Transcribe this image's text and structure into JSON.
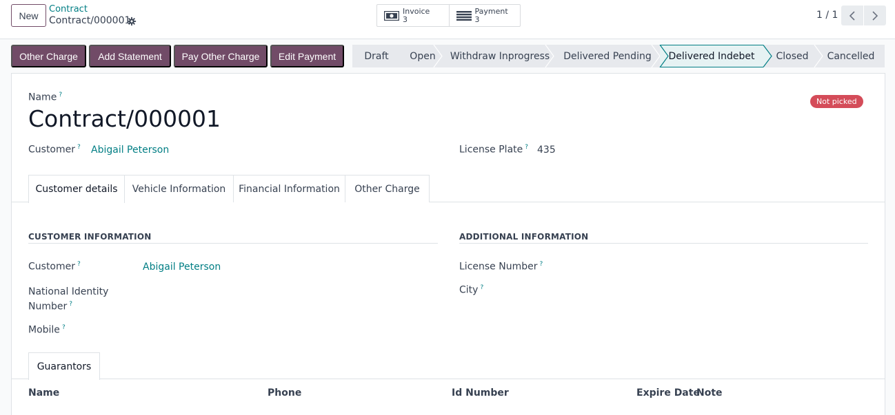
{
  "header": {
    "new_label": "New",
    "breadcrumb": "Contract",
    "record_name": "Contract/000001",
    "smart_buttons": [
      {
        "label": "Invoice",
        "count": "3",
        "icon": "money-icon"
      },
      {
        "label": "Payment",
        "count": "3",
        "icon": "list-icon"
      }
    ],
    "pager": "1 / 1"
  },
  "actions": [
    "Other Charge",
    "Add Statement",
    "Pay Other Charge",
    "Edit Payment"
  ],
  "statusbar": {
    "stages": [
      "Draft",
      "Open",
      "Withdraw Inprogress",
      "Delivered Pending",
      "Delivered Indebet",
      "Closed",
      "Cancelled"
    ],
    "active": "Delivered Indebet"
  },
  "form": {
    "name_label": "Name",
    "name_value": "Contract/000001",
    "badge": "Not picked",
    "customer_label": "Customer",
    "customer_value": "Abigail Peterson",
    "license_plate_label": "License Plate",
    "license_plate_value": "435",
    "tabs": [
      "Customer details",
      "Vehicle Information",
      "Financial Information",
      "Other Charge"
    ],
    "customer_info": {
      "title": "CUSTOMER INFORMATION",
      "customer_label": "Customer",
      "customer_value": "Abigail Peterson",
      "national_id_label_1": "National Identity",
      "national_id_label_2": "Number",
      "mobile_label": "Mobile"
    },
    "additional_info": {
      "title": "ADDITIONAL INFORMATION",
      "license_number_label": "License Number",
      "city_label": "City"
    },
    "subtab": "Guarantors",
    "guarantor_columns": [
      "Name",
      "Phone",
      "Id Number",
      "Expire Date",
      "Note"
    ]
  },
  "colors": {
    "primary": "#714b67",
    "link": "#017e84",
    "badge_danger": "#d44c59"
  }
}
